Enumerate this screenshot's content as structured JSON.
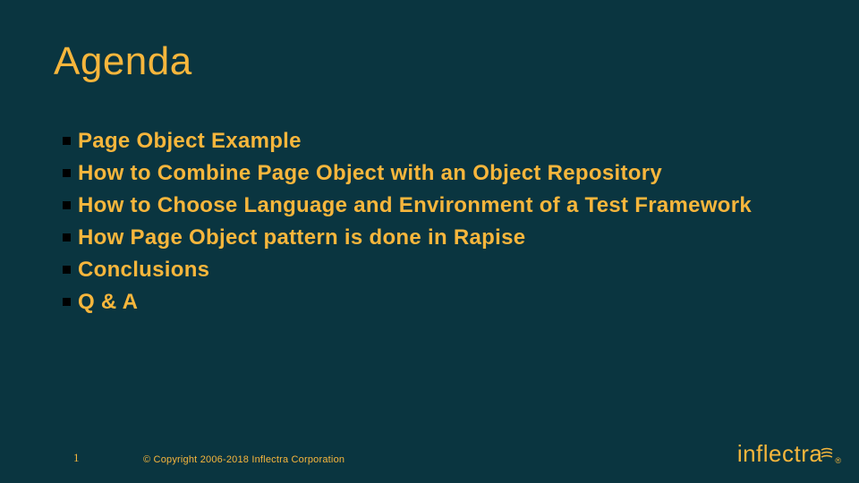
{
  "title": "Agenda",
  "items": [
    "Page Object Example",
    "How to Combine Page Object with an Object Repository",
    "How to Choose Language and Environment of a Test Framework",
    "How Page Object pattern is done in Rapise",
    "Conclusions",
    "Q & A"
  ],
  "footer": {
    "page": "1",
    "copyright": "© Copyright 2006-2018 Inflectra Corporation"
  },
  "logo": {
    "text": "inflectra",
    "reg": "®"
  }
}
